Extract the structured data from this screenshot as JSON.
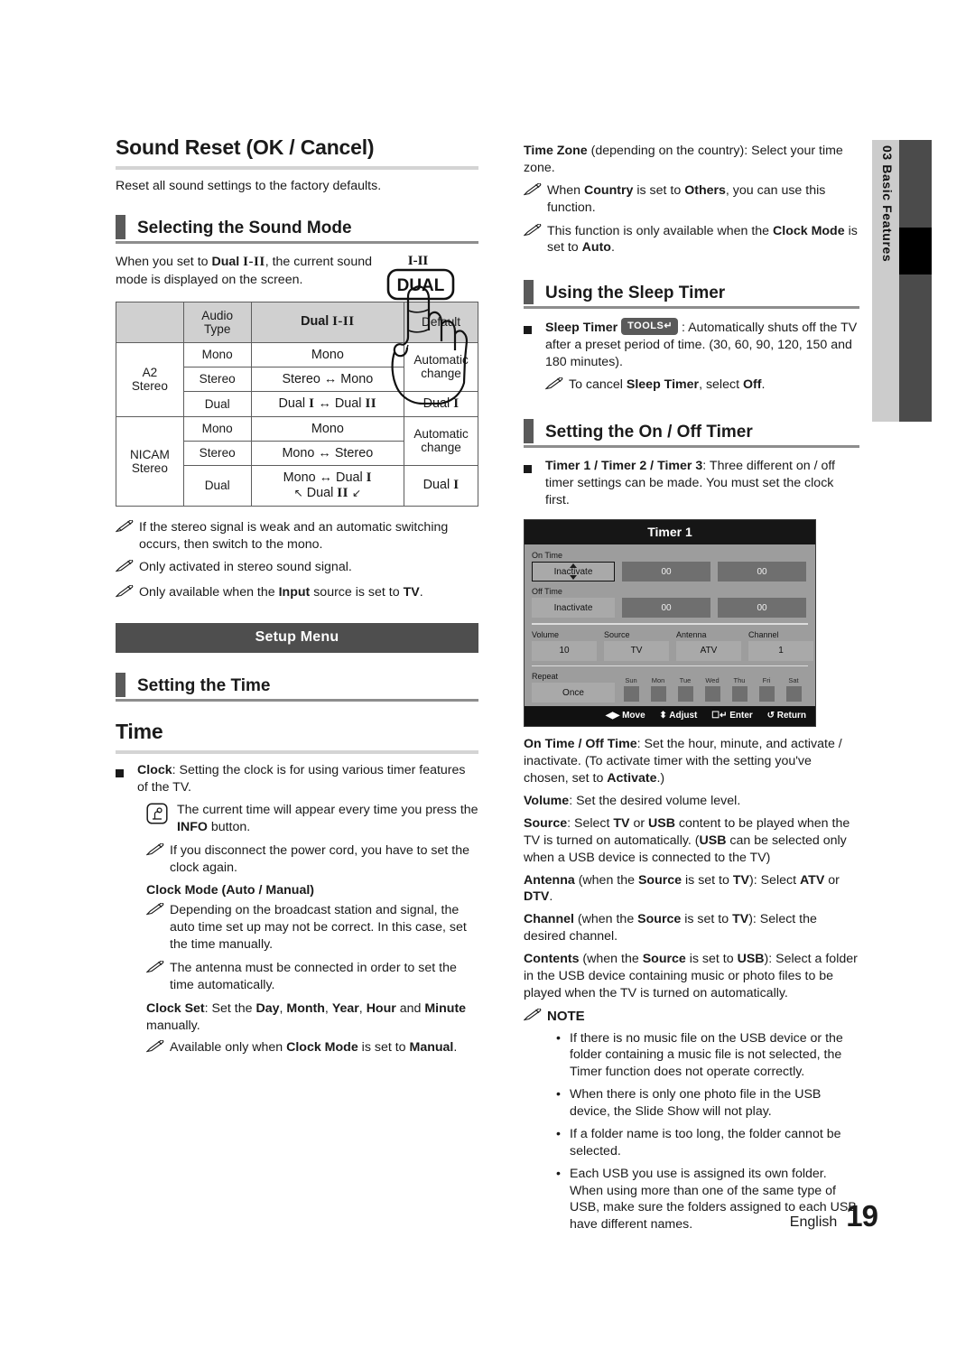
{
  "side_tab": {
    "number": "03",
    "label": "Basic Features",
    "full": "03  Basic Features"
  },
  "footer": {
    "language": "English",
    "page": "19"
  },
  "left": {
    "title": "Sound Reset (OK / Cancel)",
    "intro": "Reset all sound settings to the factory defaults.",
    "section1_title": "Selecting the Sound Mode",
    "section1_body_pre": "When you set to ",
    "section1_body_bold": "Dual",
    "section1_body_rom": "I-II",
    "section1_body_post": ", the current sound mode is displayed on the screen.",
    "illustration": {
      "top_label": "I-II",
      "button_label": "DUAL"
    },
    "table": {
      "headers": [
        "",
        "Audio Type",
        "Dual I-II",
        "Default"
      ],
      "header_audio_line1": "Audio",
      "header_audio_line2": "Type",
      "header_dual_bold": "Dual",
      "header_dual_rom": "I-II",
      "header_default": "Default",
      "groups": [
        {
          "name_line1": "A2",
          "name_line2": "Stereo",
          "rows": [
            {
              "type": "Mono",
              "dual": "Mono",
              "default": "Automatic change",
              "default_span": 2,
              "dual_bold": true
            },
            {
              "type": "Stereo",
              "dual": "Stereo ↔ Mono",
              "default": "",
              "dual_bold": true
            },
            {
              "type": "Dual",
              "dual": "Dual I ↔ Dual II",
              "default": "Dual I",
              "dual_bold": true,
              "default_bold": true
            }
          ]
        },
        {
          "name_line1": "NICAM",
          "name_line2": "Stereo",
          "rows": [
            {
              "type": "Mono",
              "dual": "Mono",
              "default": "Automatic change",
              "default_span": 2,
              "dual_bold": true
            },
            {
              "type": "Stereo",
              "dual": "Mono ↔ Stereo",
              "default": "",
              "dual_bold": true
            },
            {
              "type": "Dual",
              "dual": "Mono ↔ Dual I ↖ Dual II ↙",
              "default": "Dual I",
              "dual_bold": true,
              "default_bold": true
            }
          ]
        }
      ]
    },
    "notes": [
      "If the stereo signal is weak and an automatic switching occurs, then switch to the mono.",
      "Only activated in stereo sound signal.",
      "Only available when the Input source is set to TV."
    ],
    "banner": "Setup Menu",
    "section2_title": "Setting the Time",
    "time_title": "Time",
    "clock_label": "Clock",
    "clock_text": ": Setting the clock is for using various timer features of the TV.",
    "info_note": "The current time will appear every time you press the INFO button.",
    "power_note": "If you disconnect the power cord, you have to set the clock again.",
    "clock_mode_head": "Clock Mode (Auto / Manual)",
    "clock_mode_note1": "Depending on the broadcast station and signal, the auto time set up may not be correct. In this case, set the time manually.",
    "clock_mode_note2": "The antenna must be connected in order to set the time automatically.",
    "clock_set_label": "Clock Set",
    "clock_set_text": ": Set the Day, Month, Year, Hour and Minute manually.",
    "clock_set_note": "Available only when Clock Mode is set to Manual."
  },
  "right": {
    "timezone_label": "Time Zone",
    "timezone_text": " (depending on the country): Select your time zone.",
    "timezone_note1": "When Country is set to Others, you can use this function.",
    "timezone_note2": "This function is only available when the Clock Mode is set to Auto.",
    "sleep_title": "Using the Sleep Timer",
    "sleep_label": "Sleep Timer",
    "tools_badge": "TOOLS",
    "sleep_text": " : Automatically shuts off the TV after a preset period of time. (30, 60, 90, 120, 150 and 180 minutes).",
    "sleep_note": "To cancel Sleep Timer, select Off.",
    "onoff_title": "Setting the On / Off Timer",
    "timer_label": "Timer 1 / Timer 2 / Timer 3",
    "timer_text": ": Three different on / off timer settings can be made. You must set the clock first.",
    "osd": {
      "title": "Timer 1",
      "on_time_label": "On Time",
      "on_time_value": "Inactivate",
      "on_time_hour": "00",
      "on_time_min": "00",
      "off_time_label": "Off Time",
      "off_time_value": "Inactivate",
      "off_time_hour": "00",
      "off_time_min": "00",
      "volume_label": "Volume",
      "volume_value": "10",
      "source_label": "Source",
      "source_value": "TV",
      "antenna_label": "Antenna",
      "antenna_value": "ATV",
      "channel_label": "Channel",
      "channel_value": "1",
      "repeat_label": "Repeat",
      "repeat_value": "Once",
      "days": [
        "Sun",
        "Mon",
        "Tue",
        "Wed",
        "Thu",
        "Fri",
        "Sat"
      ],
      "footer": [
        {
          "glyph": "◀▶",
          "label": "Move"
        },
        {
          "glyph": "⬍",
          "label": "Adjust"
        },
        {
          "glyph": "↵",
          "label": "Enter"
        },
        {
          "glyph": "↺",
          "label": "Return"
        }
      ]
    },
    "onoff_desc_label": "On Time / Off Time",
    "onoff_desc_text": ": Set the hour, minute, and activate / inactivate. (To activate timer with the setting you've chosen, set to Activate.)",
    "volume_desc_label": "Volume",
    "volume_desc_text": ": Set the desired volume level.",
    "source_desc_label": "Source",
    "source_desc_text": ": Select TV or USB content to be played when the TV is turned on automatically. (USB can be selected only when a USB device is connected to the TV)",
    "antenna_desc_label": "Antenna",
    "antenna_desc_text": " (when the Source is set to TV): Select ATV or DTV.",
    "channel_desc_label": "Channel",
    "channel_desc_text": " (when the Source is set to TV): Select the desired channel.",
    "contents_desc_label": "Contents",
    "contents_desc_text": " (when the Source is set to USB): Select a folder in the USB device containing music or photo files to be played when the TV is turned on automatically.",
    "note_head": "NOTE",
    "note_bullets": [
      "If there is no music file on the USB device or the folder containing a music file is not selected, the Timer function does not operate correctly.",
      "When there is only one photo file in the USB device, the Slide Show will not play.",
      "If a folder name is too long, the folder cannot be selected.",
      "Each USB you use is assigned its own folder. When using more than one of the same type of USB, make sure the folders assigned to each USB have different names."
    ]
  },
  "colors": {
    "tab_grey": "#cccccc",
    "bar_dark": "#4b4b4b",
    "banner": "#4e4e4e",
    "table_header": "#d0d0d0",
    "osd_bg": "#9d9d9d",
    "osd_title": "#161616"
  }
}
